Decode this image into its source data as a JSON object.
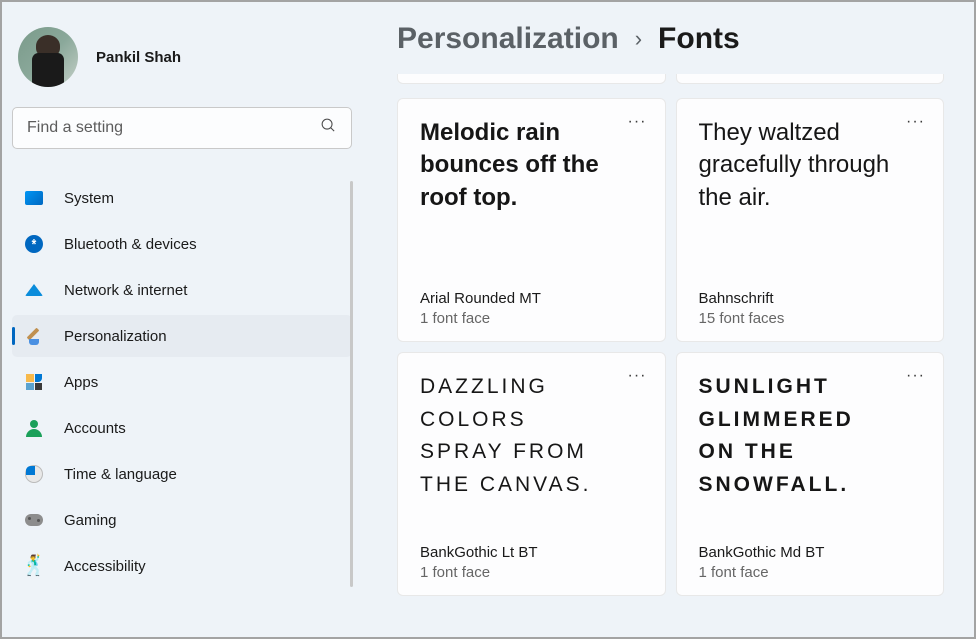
{
  "user": {
    "name": "Pankil Shah"
  },
  "search": {
    "placeholder": "Find a setting"
  },
  "sidebar": {
    "items": [
      {
        "label": "System",
        "icon": "system"
      },
      {
        "label": "Bluetooth & devices",
        "icon": "bluetooth"
      },
      {
        "label": "Network & internet",
        "icon": "network"
      },
      {
        "label": "Personalization",
        "icon": "personalization",
        "active": true
      },
      {
        "label": "Apps",
        "icon": "apps"
      },
      {
        "label": "Accounts",
        "icon": "accounts"
      },
      {
        "label": "Time & language",
        "icon": "time"
      },
      {
        "label": "Gaming",
        "icon": "gaming"
      },
      {
        "label": "Accessibility",
        "icon": "accessibility"
      }
    ]
  },
  "breadcrumb": {
    "parent": "Personalization",
    "separator": "›",
    "current": "Fonts"
  },
  "fonts": [
    {
      "sample": "Melodic rain bounces off the roof top.",
      "name": "Arial Rounded MT",
      "faces": "1 font face",
      "styleClass": "sample-arial"
    },
    {
      "sample": "They waltzed gracefully through the air.",
      "name": "Bahnschrift",
      "faces": "15 font faces",
      "styleClass": "sample-bahn"
    },
    {
      "sample": "Dazzling colors spray from the canvas.",
      "name": "BankGothic Lt BT",
      "faces": "1 font face",
      "styleClass": "sample-bankgothic"
    },
    {
      "sample": "Sunlight glimmered on the snowfall.",
      "name": "BankGothic Md BT",
      "faces": "1 font face",
      "styleClass": "sample-bankgothic-md"
    }
  ],
  "moreGlyph": "···"
}
